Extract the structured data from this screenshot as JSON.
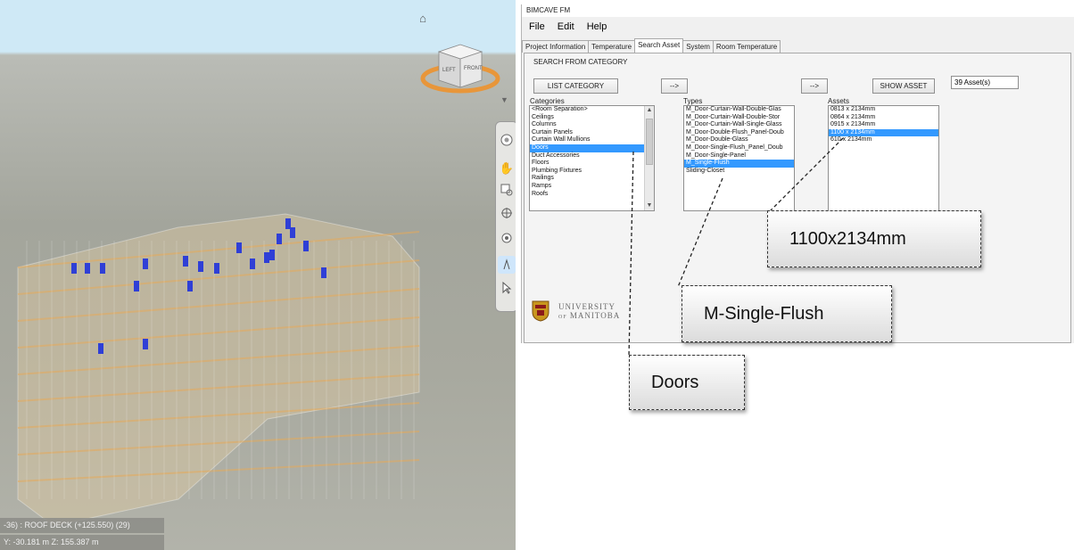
{
  "window": {
    "title": "BIMCAVE FM"
  },
  "menu": [
    "File",
    "Edit",
    "Help"
  ],
  "tabs": [
    {
      "label": "Project Information",
      "active": false
    },
    {
      "label": "Temperature",
      "active": false
    },
    {
      "label": "Search Asset",
      "active": true
    },
    {
      "label": "System",
      "active": false
    },
    {
      "label": "Room Temperature",
      "active": false
    }
  ],
  "search": {
    "section_title": "SEARCH FROM CATEGORY",
    "list_category_label": "LIST CATEGORY",
    "arrow_label": "-->",
    "show_asset_label": "SHOW ASSET",
    "asset_count": "39 Asset(s)",
    "categories_label": "Categories",
    "types_label": "Types",
    "assets_label": "Assets",
    "categories": [
      "<Room Separation>",
      "Ceilings",
      "Columns",
      "Curtain Panels",
      "Curtain Wall Mullions",
      "Doors",
      "Duct Accessories",
      "Floors",
      "Plumbing Fixtures",
      "Railings",
      "Ramps",
      "Roofs"
    ],
    "categories_selected": 5,
    "types": [
      "M_Door-Curtain-Wall-Double-Glas",
      "M_Door-Curtain-Wall-Double-Stor",
      "M_Door-Curtain-Wall-Single-Glass",
      "M_Door-Double-Flush_Panel-Doub",
      "M_Door-Double-Glass",
      "M_Door-Single-Flush_Panel_Doub",
      "M_Door-Single-Panel",
      "M_Single-Flush",
      "Sliding-Closet"
    ],
    "types_selected": 7,
    "assets": [
      "0813 x 2134mm",
      "0864 x 2134mm",
      "0915 x 2134mm",
      "1100 x 2134mm",
      "610 x 2134mm"
    ],
    "assets_selected": 3
  },
  "logo": {
    "line1": "UNIVERSITY",
    "line2_prefix": "OF",
    "line2": "MANITOBA"
  },
  "callouts": {
    "asset": "1100x2134mm",
    "type": "M-Single-Flush",
    "category": "Doors"
  },
  "viewcube": {
    "left": "LEFT",
    "front": "FRONT"
  },
  "status": {
    "level": "-36) : ROOF DECK (+125.550) (29)",
    "coords": "Y: -30.181 m  Z: 155.387 m"
  },
  "colors": {
    "selection": "#3399ff",
    "door_marks": "#2f3fd6",
    "orange_ring": "#f0a040"
  }
}
